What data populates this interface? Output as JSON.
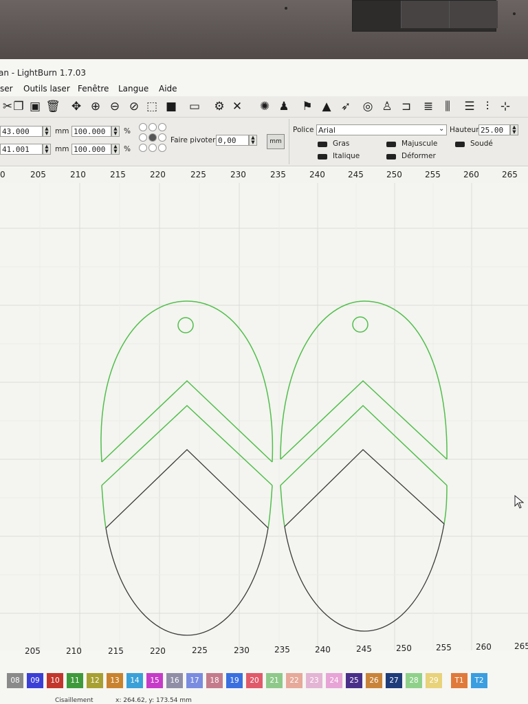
{
  "window": {
    "title": "an - LightBurn 1.7.03"
  },
  "menu": [
    "ser",
    "Outils laser",
    "Fenêtre",
    "Langue",
    "Aide"
  ],
  "props": {
    "pos_x": "43.000",
    "pos_y": "41.001",
    "unit_mm": "mm",
    "scale_w": "100.000",
    "scale_h": "100.000",
    "percent": "%",
    "rotate_label": "Faire pivoter",
    "rotate_value": "0,00",
    "mm_button": "mm",
    "font_label": "Police",
    "font_value": "Arial",
    "height_label": "Hauteur",
    "height_value": "25.00",
    "bold": "Gras",
    "italic": "Italique",
    "upper": "Majuscule",
    "distort": "Déformer",
    "weld": "Soudé"
  },
  "ruler_top": [
    "0",
    "205",
    "210",
    "215",
    "220",
    "225",
    "230",
    "235",
    "240",
    "245",
    "250",
    "255",
    "260",
    "265"
  ],
  "ruler_bottom": [
    "205",
    "210",
    "215",
    "220",
    "225",
    "230",
    "235",
    "240",
    "245",
    "250",
    "255",
    "260",
    "265"
  ],
  "palette": [
    {
      "label": "08",
      "color": "#8a8a8a"
    },
    {
      "label": "09",
      "color": "#3b3fd6"
    },
    {
      "label": "10",
      "color": "#c2362c"
    },
    {
      "label": "11",
      "color": "#3e9a3a"
    },
    {
      "label": "12",
      "color": "#a7a032"
    },
    {
      "label": "13",
      "color": "#c9822d"
    },
    {
      "label": "14",
      "color": "#3aa0d8"
    },
    {
      "label": "15",
      "color": "#c63bc8"
    },
    {
      "label": "16",
      "color": "#8f8ea6"
    },
    {
      "label": "17",
      "color": "#7a8ce0"
    },
    {
      "label": "18",
      "color": "#c47c8c"
    },
    {
      "label": "19",
      "color": "#3a6fe0"
    },
    {
      "label": "20",
      "color": "#e05a6a"
    },
    {
      "label": "21",
      "color": "#8ec98a"
    },
    {
      "label": "22",
      "color": "#e6a99a"
    },
    {
      "label": "23",
      "color": "#e3b4d4"
    },
    {
      "label": "24",
      "color": "#e7a4d6"
    },
    {
      "label": "25",
      "color": "#4a2f8a"
    },
    {
      "label": "26",
      "color": "#c9843a"
    },
    {
      "label": "27",
      "color": "#1e3c7a"
    },
    {
      "label": "28",
      "color": "#8fd18a"
    },
    {
      "label": "29",
      "color": "#e8d27a"
    },
    {
      "label": "T1",
      "color": "#e07a3a"
    },
    {
      "label": "T2",
      "color": "#3a9ee0"
    }
  ],
  "status": {
    "mode": "Cisaillement",
    "coords": "x: 264.62, y: 173.54 mm"
  },
  "colors": {
    "layer_green": "#4fbf4a",
    "path_dark": "#3a3a3a",
    "grid": "#d9d9d4"
  }
}
